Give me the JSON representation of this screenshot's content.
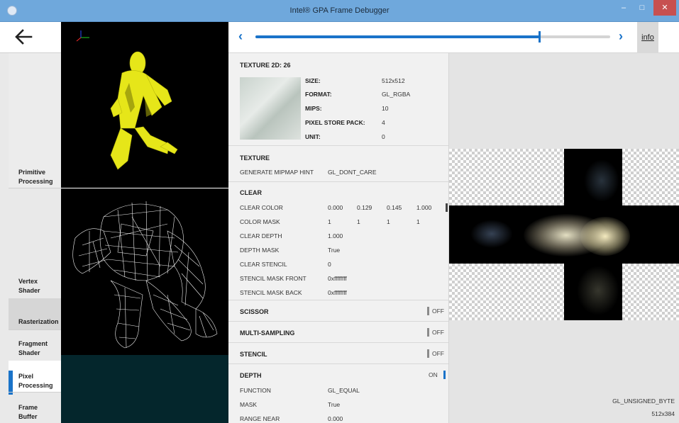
{
  "window": {
    "title": "Intel® GPA Frame Debugger",
    "min": "–",
    "max": "□",
    "close": "✕"
  },
  "nav": {
    "items": [
      {
        "label_1": "Primitive",
        "label_2": "Processing"
      },
      {
        "label_1": "Vertex",
        "label_2": "Shader"
      },
      {
        "label_1": "Rasterization",
        "label_2": ""
      },
      {
        "label_1": "Fragment",
        "label_2": "Shader"
      },
      {
        "label_1": "Pixel",
        "label_2": "Processing"
      },
      {
        "label_1": "Frame",
        "label_2": "Buffer"
      }
    ],
    "active_index": 4
  },
  "topbar": {
    "prev": "‹",
    "next": "›",
    "info_label": "info",
    "slider_fraction": 0.8
  },
  "texture": {
    "title": "TEXTURE 2D: 26",
    "props": [
      {
        "label": "SIZE:",
        "value": "512x512"
      },
      {
        "label": "FORMAT:",
        "value": "GL_RGBA"
      },
      {
        "label": "MIPS:",
        "value": "10"
      },
      {
        "label": "PIXEL STORE PACK:",
        "value": "4"
      },
      {
        "label": "UNIT:",
        "value": "0"
      }
    ]
  },
  "texture_section": {
    "title": "TEXTURE",
    "generate_mipmap_hint_label": "GENERATE MIPMAP HINT",
    "generate_mipmap_hint_value": "GL_DONT_CARE"
  },
  "clear": {
    "title": "CLEAR",
    "clear_color_label": "CLEAR COLOR",
    "clear_color": [
      "0.000",
      "0.129",
      "0.145",
      "1.000"
    ],
    "color_mask_label": "COLOR MASK",
    "color_mask": [
      "1",
      "1",
      "1",
      "1"
    ],
    "clear_depth_label": "CLEAR DEPTH",
    "clear_depth": "1.000",
    "depth_mask_label": "DEPTH MASK",
    "depth_mask": "True",
    "clear_stencil_label": "CLEAR STENCIL",
    "clear_stencil": "0",
    "stencil_mask_front_label": "STENCIL MASK FRONT",
    "stencil_mask_front": "0xffffffff",
    "stencil_mask_back_label": "STENCIL MASK BACK",
    "stencil_mask_back": "0xffffffff"
  },
  "scissor": {
    "title": "SCISSOR",
    "state": "OFF"
  },
  "multisampling": {
    "title": "MULTI-SAMPLING",
    "state": "OFF"
  },
  "stencil": {
    "title": "STENCIL",
    "state": "OFF"
  },
  "depth": {
    "title": "DEPTH",
    "state": "ON",
    "function_label": "FUNCTION",
    "function": "GL_EQUAL",
    "mask_label": "MASK",
    "mask": "True",
    "range_near_label": "RANGE NEAR",
    "range_near": "0.000"
  },
  "preview": {
    "type": "GL_UNSIGNED_BYTE",
    "size": "512x384"
  },
  "colors": {
    "accent": "#1a73c9",
    "titlebar": "#6fa8dc",
    "close": "#c75050",
    "model": "#e8e81a"
  }
}
